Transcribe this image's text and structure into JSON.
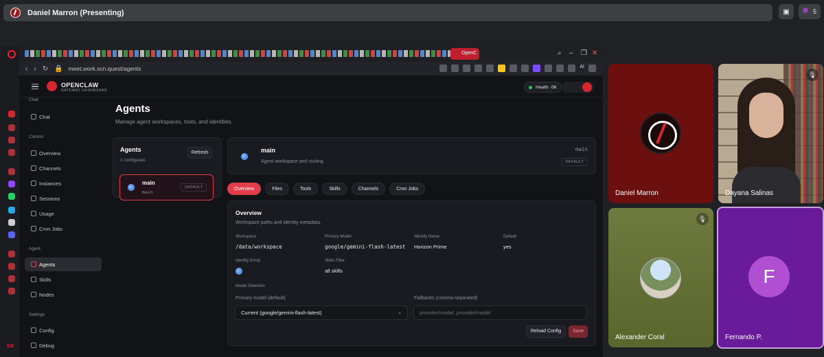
{
  "meet": {
    "presenting_label": "Daniel Marron (Presenting)",
    "participant_count": "5",
    "tiles": [
      {
        "name": "Daniel Marron",
        "bg": "#6b0f0f"
      },
      {
        "name": "Dayana Salinas"
      },
      {
        "name": "Alexander Coral"
      },
      {
        "name": "Fernando P.",
        "initial": "F",
        "bg": "#6a1b9a"
      }
    ]
  },
  "browser": {
    "active_tab_label": "OpenC",
    "url": "meet.work.scn.quest/agents",
    "ai_label": "AI",
    "gx_label": "GX"
  },
  "app": {
    "brand_name": "OPENCLAW",
    "brand_subtitle": "GATEWAY DASHBOARD",
    "health_label": "Health",
    "health_value": "OK",
    "sidebar": {
      "sections": [
        {
          "label": "Chat",
          "items": [
            "Chat"
          ]
        },
        {
          "label": "Control",
          "items": [
            "Overview",
            "Channels",
            "Instances",
            "Sessions",
            "Usage",
            "Cron Jobs"
          ]
        },
        {
          "label": "Agent",
          "items": [
            "Agents",
            "Skills",
            "Nodes"
          ]
        },
        {
          "label": "Settings",
          "items": [
            "Config",
            "Debug"
          ]
        }
      ],
      "active_item": "Agents"
    },
    "page_title": "Agents",
    "page_subtitle": "Manage agent workspaces, tools, and identities.",
    "agents_card": {
      "title": "Agents",
      "count_text": "1 configured.",
      "refresh_label": "Refresh",
      "agent": {
        "name": "main",
        "id": "main",
        "badge": "DEFAULT"
      }
    },
    "detail_header": {
      "name": "main",
      "subtitle": "Agent workspace and routing.",
      "id": "main",
      "badge": "DEFAULT"
    },
    "tabs": [
      "Overview",
      "Files",
      "Tools",
      "Skills",
      "Channels",
      "Cron Jobs"
    ],
    "active_tab": "Overview",
    "overview": {
      "title": "Overview",
      "subtitle": "Workspace paths and identity metadata.",
      "fields": [
        {
          "label": "Workspace",
          "value": "/data/workspace"
        },
        {
          "label": "Primary Model",
          "value": "google/gemini-flash-latest"
        },
        {
          "label": "Identity Name",
          "value": "Horizon Prime"
        },
        {
          "label": "Default",
          "value": "yes"
        },
        {
          "label": "Identity Emoji",
          "value": ""
        },
        {
          "label": "Skills Filter",
          "value": "all skills"
        }
      ],
      "model_selection_label": "Model Selection",
      "primary_model_label": "Primary model (default)",
      "primary_model_value": "Current (google/gemini-flash-latest)",
      "fallbacks_label": "Fallbacks (comma-separated)",
      "fallbacks_placeholder": "provider/model, provider/model",
      "reload_label": "Reload Config",
      "save_label": "Save"
    }
  }
}
